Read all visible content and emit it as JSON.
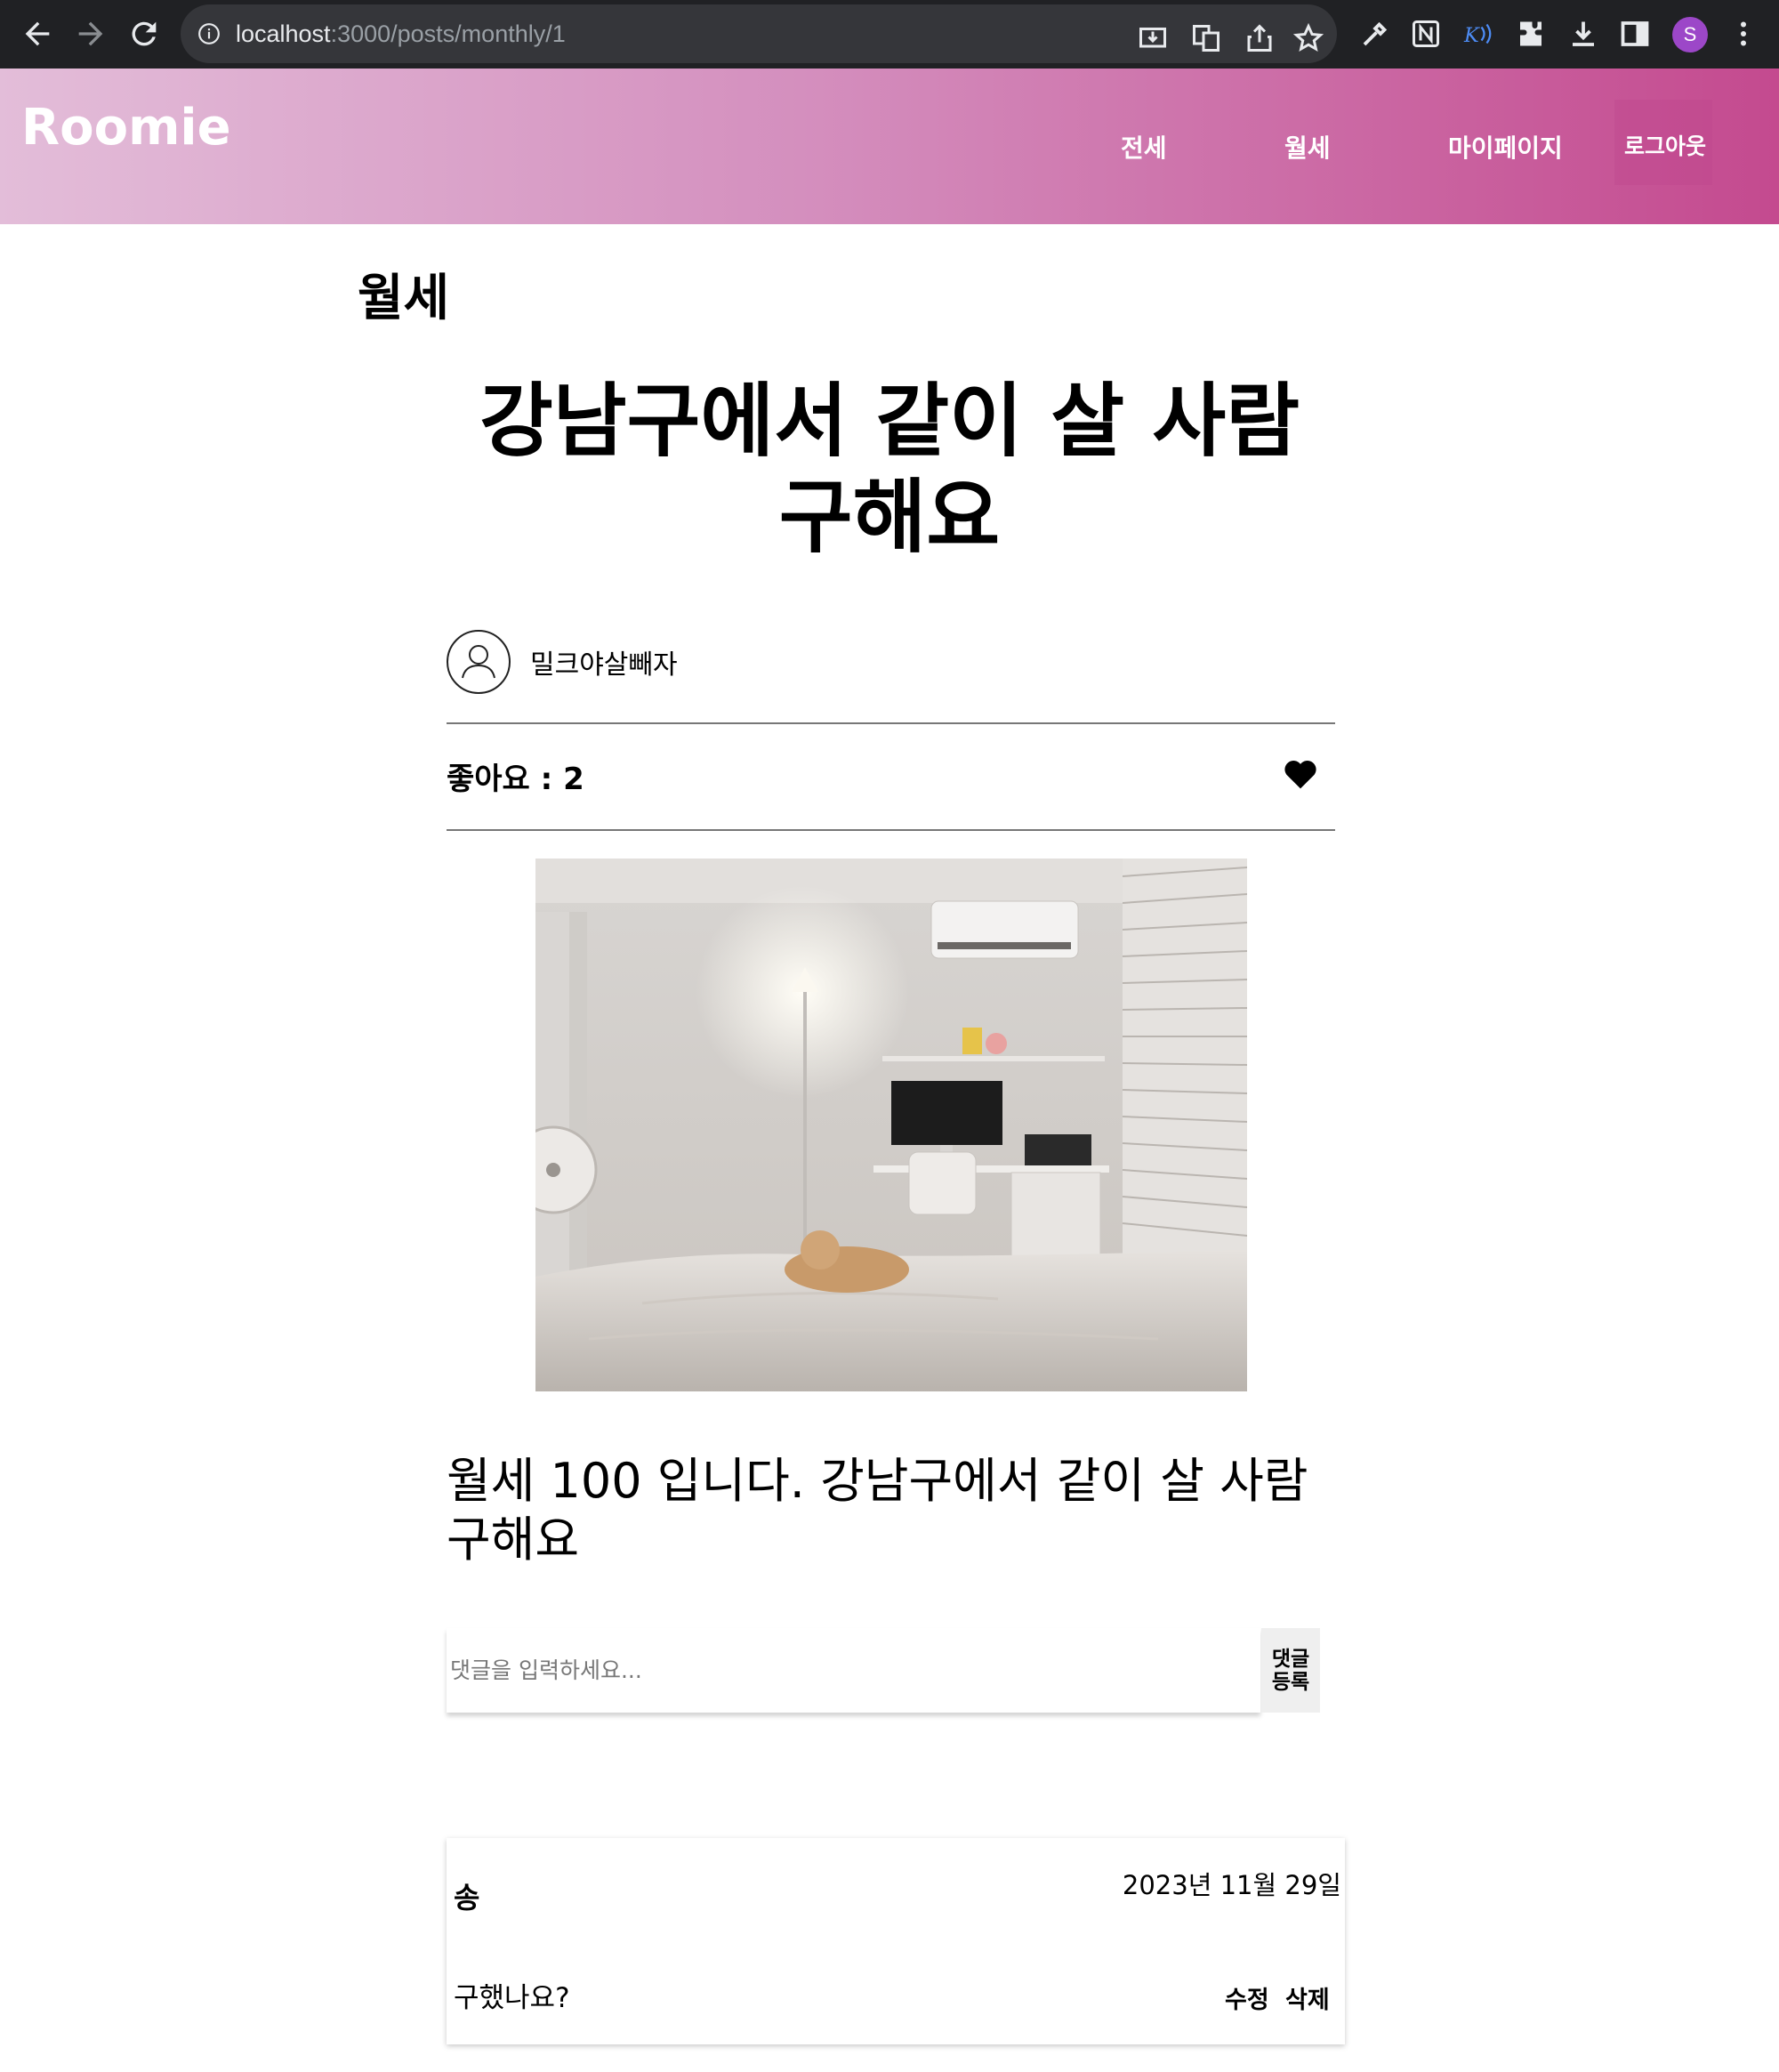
{
  "browser": {
    "url_host": "localhost",
    "url_path": ":3000/posts/monthly/1",
    "profile_initial": "S"
  },
  "header": {
    "brand": "Roomie",
    "nav": {
      "jeonse": "전세",
      "monthly": "월세",
      "mypage": "마이페이지",
      "logout": "로그아웃"
    }
  },
  "post": {
    "category": "월세",
    "title": "강남구에서 같이 살 사람 구해요",
    "author": "밀크야살빼자",
    "likes_label": "좋아요 : 2",
    "body": "월세 100 입니다. 강남구에서 같이 살 사람 구해요"
  },
  "comment_form": {
    "placeholder": "댓글을 입력하세요...",
    "submit_label": "댓글 등록"
  },
  "comments": [
    {
      "author": "송",
      "date": "2023년 11월 29일",
      "text": "구했나요?",
      "edit_label": "수정",
      "delete_label": "삭제"
    }
  ],
  "colors": {
    "header_gradient_start": "#e3bdd9",
    "header_gradient_end": "#c44a8f",
    "chrome_bg": "#202124"
  }
}
